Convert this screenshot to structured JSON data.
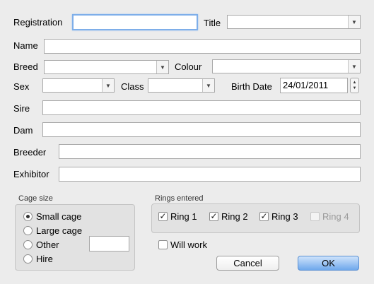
{
  "form": {
    "registration_label": "Registration",
    "registration_value": "",
    "title_label": "Title",
    "title_value": "",
    "name_label": "Name",
    "name_value": "",
    "breed_label": "Breed",
    "breed_value": "",
    "colour_label": "Colour",
    "colour_value": "",
    "sex_label": "Sex",
    "sex_value": "",
    "class_label": "Class",
    "class_value": "",
    "birth_date_label": "Birth Date",
    "birth_date_value": "24/01/2011",
    "sire_label": "Sire",
    "sire_value": "",
    "dam_label": "Dam",
    "dam_value": "",
    "breeder_label": "Breeder",
    "breeder_value": "",
    "exhibitor_label": "Exhibitor",
    "exhibitor_value": ""
  },
  "cage_size": {
    "title": "Cage size",
    "options": [
      {
        "label": "Small cage",
        "selected": true
      },
      {
        "label": "Large cage",
        "selected": false
      },
      {
        "label": "Other",
        "selected": false
      },
      {
        "label": "Hire",
        "selected": false
      }
    ],
    "other_value": ""
  },
  "rings": {
    "title": "Rings entered",
    "items": [
      {
        "label": "Ring 1",
        "checked": true,
        "enabled": true
      },
      {
        "label": "Ring 2",
        "checked": true,
        "enabled": true
      },
      {
        "label": "Ring 3",
        "checked": true,
        "enabled": true
      },
      {
        "label": "Ring 4",
        "checked": false,
        "enabled": false
      }
    ]
  },
  "will_work": {
    "label": "Will work",
    "checked": false
  },
  "buttons": {
    "cancel": "Cancel",
    "ok": "OK"
  },
  "colors": {
    "focus_ring": "#7eaee9",
    "default_button": "#6fa8ec",
    "background": "#ececec"
  },
  "icons": {
    "dropdown": "chevron-down-icon",
    "stepper": "stepper-icon",
    "check": "checkmark-icon"
  }
}
